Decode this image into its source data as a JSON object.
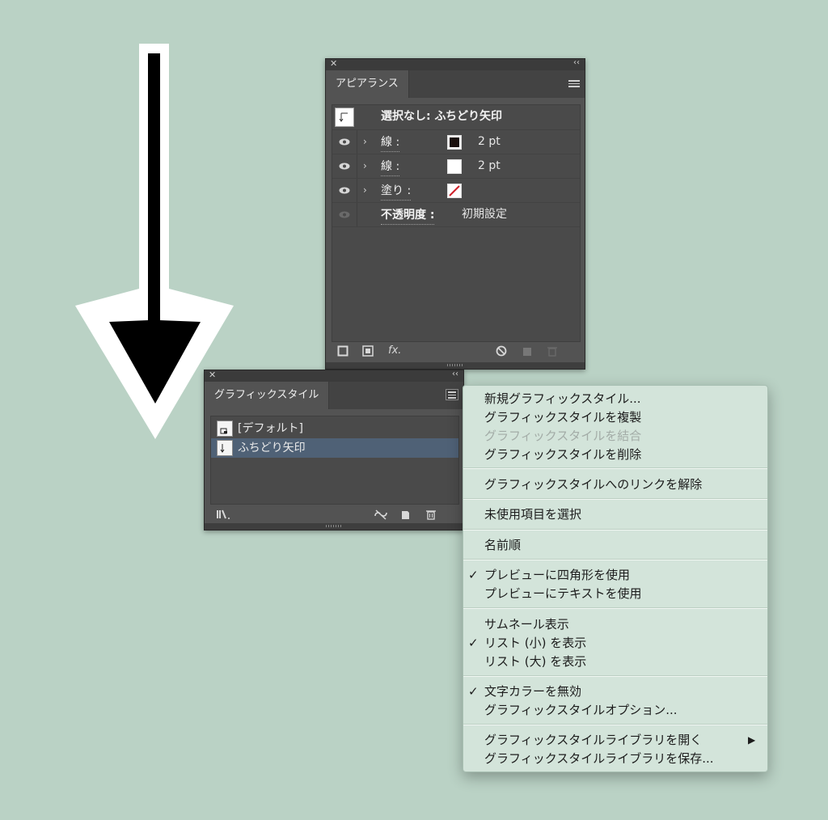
{
  "appearance_panel": {
    "tab": "アピアランス",
    "header_label": "選択なし: ふちどり矢印",
    "rows": [
      {
        "label": "線 :",
        "value": "2 pt",
        "swatch": "#1a0f0c"
      },
      {
        "label": "線 :",
        "value": "2 pt",
        "swatch": "#ffffff"
      },
      {
        "label": "塗り :",
        "value": "",
        "swatch": "none"
      },
      {
        "label": "不透明度 :",
        "value": "初期設定"
      }
    ],
    "fx_label": "fx."
  },
  "graphic_styles_panel": {
    "tab": "グラフィックスタイル",
    "items": [
      {
        "label": "[デフォルト]"
      },
      {
        "label": "ふちどり矢印",
        "selected": true
      }
    ]
  },
  "flyout_menu": {
    "items": [
      {
        "label": "新規グラフィックスタイル..."
      },
      {
        "label": "グラフィックスタイルを複製"
      },
      {
        "label": "グラフィックスタイルを結合",
        "disabled": true
      },
      {
        "label": "グラフィックスタイルを削除"
      },
      {
        "label": "グラフィックスタイルへのリンクを解除"
      },
      {
        "label": "未使用項目を選択"
      },
      {
        "label": "名前順"
      },
      {
        "label": "プレビューに四角形を使用",
        "checked": true
      },
      {
        "label": "プレビューにテキストを使用"
      },
      {
        "label": "サムネール表示"
      },
      {
        "label": "リスト (小) を表示",
        "checked": true
      },
      {
        "label": "リスト (大) を表示"
      },
      {
        "label": "文字カラーを無効",
        "checked": true
      },
      {
        "label": "グラフィックスタイルオプション..."
      },
      {
        "label": "グラフィックスタイルライブラリを開く",
        "submenu": true
      },
      {
        "label": "グラフィックスタイルライブラリを保存..."
      }
    ],
    "check_glyph": "✓",
    "submenu_glyph": "▶"
  },
  "colors": {
    "background": "#bad2c5",
    "panel": "#535353",
    "selection": "#4f6176",
    "menu": "#d3e4da"
  }
}
